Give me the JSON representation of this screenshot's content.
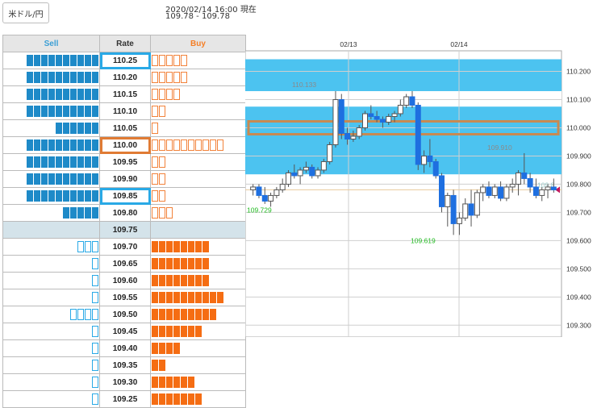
{
  "pair_button": "米ドル/円",
  "timestamp": "2020/02/14 16:00 現在",
  "price_range": "109.78 - 109.78",
  "book": {
    "headers": {
      "sell": "Sell",
      "rate": "Rate",
      "buy": "Buy"
    },
    "rows": [
      {
        "rate": "110.25",
        "sell_filled": 10,
        "sell_outline": 0,
        "buy_filled": 0,
        "buy_outline": 5,
        "zone": "up",
        "highlight": "blue"
      },
      {
        "rate": "110.20",
        "sell_filled": 10,
        "sell_outline": 0,
        "buy_filled": 0,
        "buy_outline": 5,
        "zone": "up",
        "highlight": ""
      },
      {
        "rate": "110.15",
        "sell_filled": 10,
        "sell_outline": 0,
        "buy_filled": 0,
        "buy_outline": 4,
        "zone": "up",
        "highlight": ""
      },
      {
        "rate": "110.10",
        "sell_filled": 10,
        "sell_outline": 0,
        "buy_filled": 0,
        "buy_outline": 2,
        "zone": "up",
        "highlight": ""
      },
      {
        "rate": "110.05",
        "sell_filled": 6,
        "sell_outline": 0,
        "buy_filled": 0,
        "buy_outline": 1,
        "zone": "up",
        "highlight": ""
      },
      {
        "rate": "110.00",
        "sell_filled": 10,
        "sell_outline": 0,
        "buy_filled": 0,
        "buy_outline": 10,
        "zone": "up",
        "highlight": "orange"
      },
      {
        "rate": "109.95",
        "sell_filled": 10,
        "sell_outline": 0,
        "buy_filled": 0,
        "buy_outline": 2,
        "zone": "up",
        "highlight": ""
      },
      {
        "rate": "109.90",
        "sell_filled": 10,
        "sell_outline": 0,
        "buy_filled": 0,
        "buy_outline": 2,
        "zone": "up",
        "highlight": ""
      },
      {
        "rate": "109.85",
        "sell_filled": 10,
        "sell_outline": 0,
        "buy_filled": 0,
        "buy_outline": 2,
        "zone": "up",
        "highlight": "blue"
      },
      {
        "rate": "109.80",
        "sell_filled": 5,
        "sell_outline": 0,
        "buy_filled": 0,
        "buy_outline": 3,
        "zone": "up",
        "highlight": ""
      },
      {
        "rate": "109.75",
        "sell_filled": 0,
        "sell_outline": 0,
        "buy_filled": 0,
        "buy_outline": 0,
        "zone": "mid",
        "highlight": ""
      },
      {
        "rate": "109.70",
        "sell_filled": 0,
        "sell_outline": 3,
        "buy_filled": 8,
        "buy_outline": 0,
        "zone": "down",
        "highlight": ""
      },
      {
        "rate": "109.65",
        "sell_filled": 0,
        "sell_outline": 1,
        "buy_filled": 8,
        "buy_outline": 0,
        "zone": "down",
        "highlight": ""
      },
      {
        "rate": "109.60",
        "sell_filled": 0,
        "sell_outline": 1,
        "buy_filled": 8,
        "buy_outline": 0,
        "zone": "down",
        "highlight": ""
      },
      {
        "rate": "109.55",
        "sell_filled": 0,
        "sell_outline": 1,
        "buy_filled": 10,
        "buy_outline": 0,
        "zone": "down",
        "highlight": ""
      },
      {
        "rate": "109.50",
        "sell_filled": 0,
        "sell_outline": 4,
        "buy_filled": 9,
        "buy_outline": 0,
        "zone": "down",
        "highlight": ""
      },
      {
        "rate": "109.45",
        "sell_filled": 0,
        "sell_outline": 1,
        "buy_filled": 7,
        "buy_outline": 0,
        "zone": "down",
        "highlight": ""
      },
      {
        "rate": "109.40",
        "sell_filled": 0,
        "sell_outline": 1,
        "buy_filled": 4,
        "buy_outline": 0,
        "zone": "down",
        "highlight": ""
      },
      {
        "rate": "109.35",
        "sell_filled": 0,
        "sell_outline": 1,
        "buy_filled": 2,
        "buy_outline": 0,
        "zone": "down",
        "highlight": ""
      },
      {
        "rate": "109.30",
        "sell_filled": 0,
        "sell_outline": 1,
        "buy_filled": 6,
        "buy_outline": 0,
        "zone": "down",
        "highlight": ""
      },
      {
        "rate": "109.25",
        "sell_filled": 0,
        "sell_outline": 1,
        "buy_filled": 7,
        "buy_outline": 0,
        "zone": "down",
        "highlight": ""
      }
    ]
  },
  "colors": {
    "sell_header": "#3a9fd5",
    "buy_header": "#f57e25",
    "sell_block": "#1e8ac8",
    "buy_block": "#f56d13",
    "band": "#4cc3f0",
    "band_highlight": "#c88a52",
    "candle": "#1e6fe0",
    "candle_light": "#ffffff",
    "annotation_high": "#8a8a8a",
    "annotation_low": "#22bb22"
  },
  "chart_data": {
    "type": "candlestick",
    "x": [
      "02/13",
      "02/14"
    ],
    "y_ticks": [
      "110.200",
      "110.100",
      "110.000",
      "109.900",
      "109.800",
      "109.700",
      "109.600",
      "109.500",
      "109.400",
      "109.300"
    ],
    "ylim": [
      109.258,
      110.273
    ],
    "band": {
      "from": 109.835,
      "to": 110.243
    },
    "white_gap": {
      "from": 110.075,
      "to": 110.13
    },
    "highlight_rate": 110.0,
    "current_price": 109.78,
    "current_label": "109.8",
    "annotations": [
      {
        "text": "110.133",
        "value": 110.133
      },
      {
        "text": "109.729",
        "value": 109.729
      },
      {
        "text": "109.619",
        "value": 109.619
      },
      {
        "text": "109.910",
        "value": 109.91
      }
    ],
    "candles": [
      [
        109.78,
        109.8,
        109.76,
        109.79
      ],
      [
        109.79,
        109.8,
        109.75,
        109.76
      ],
      [
        109.76,
        109.79,
        109.73,
        109.74
      ],
      [
        109.74,
        109.77,
        109.72,
        109.76
      ],
      [
        109.76,
        109.79,
        109.75,
        109.78
      ],
      [
        109.78,
        109.82,
        109.77,
        109.8
      ],
      [
        109.8,
        109.85,
        109.79,
        109.84
      ],
      [
        109.84,
        109.87,
        109.82,
        109.83
      ],
      [
        109.83,
        109.86,
        109.8,
        109.85
      ],
      [
        109.85,
        109.88,
        109.84,
        109.86
      ],
      [
        109.86,
        109.87,
        109.82,
        109.83
      ],
      [
        109.83,
        109.86,
        109.82,
        109.85
      ],
      [
        109.85,
        109.89,
        109.84,
        109.88
      ],
      [
        109.88,
        109.95,
        109.87,
        109.94
      ],
      [
        109.94,
        110.13,
        109.93,
        110.1
      ],
      [
        110.1,
        110.12,
        109.96,
        109.98
      ],
      [
        109.98,
        110.0,
        109.94,
        109.96
      ],
      [
        109.96,
        109.99,
        109.95,
        109.97
      ],
      [
        109.97,
        110.01,
        109.96,
        110.0
      ],
      [
        110.0,
        110.06,
        109.99,
        110.05
      ],
      [
        110.05,
        110.08,
        110.03,
        110.04
      ],
      [
        110.04,
        110.06,
        110.02,
        110.03
      ],
      [
        110.03,
        110.04,
        110.0,
        110.02
      ],
      [
        110.02,
        110.05,
        110.01,
        110.04
      ],
      [
        110.04,
        110.06,
        110.02,
        110.05
      ],
      [
        110.05,
        110.1,
        110.04,
        110.08
      ],
      [
        110.08,
        110.12,
        110.07,
        110.11
      ],
      [
        110.11,
        110.13,
        110.07,
        110.08
      ],
      [
        110.08,
        110.09,
        109.85,
        109.87
      ],
      [
        109.87,
        109.92,
        109.84,
        109.9
      ],
      [
        109.9,
        109.96,
        109.86,
        109.88
      ],
      [
        109.88,
        109.89,
        109.82,
        109.83
      ],
      [
        109.83,
        109.84,
        109.7,
        109.72
      ],
      [
        109.72,
        109.77,
        109.65,
        109.76
      ],
      [
        109.76,
        109.78,
        109.62,
        109.66
      ],
      [
        109.66,
        109.7,
        109.62,
        109.68
      ],
      [
        109.68,
        109.75,
        109.67,
        109.73
      ],
      [
        109.73,
        109.78,
        109.65,
        109.69
      ],
      [
        109.69,
        109.78,
        109.68,
        109.77
      ],
      [
        109.77,
        109.8,
        109.74,
        109.79
      ],
      [
        109.79,
        109.81,
        109.75,
        109.76
      ],
      [
        109.76,
        109.8,
        109.75,
        109.79
      ],
      [
        109.79,
        109.81,
        109.74,
        109.75
      ],
      [
        109.75,
        109.8,
        109.74,
        109.79
      ],
      [
        109.79,
        109.82,
        109.77,
        109.8
      ],
      [
        109.8,
        109.85,
        109.76,
        109.84
      ],
      [
        109.84,
        109.91,
        109.8,
        109.82
      ],
      [
        109.82,
        109.84,
        109.77,
        109.79
      ],
      [
        109.79,
        109.82,
        109.75,
        109.76
      ],
      [
        109.76,
        109.79,
        109.74,
        109.78
      ],
      [
        109.78,
        109.8,
        109.75,
        109.79
      ],
      [
        109.79,
        109.82,
        109.77,
        109.78
      ]
    ]
  }
}
